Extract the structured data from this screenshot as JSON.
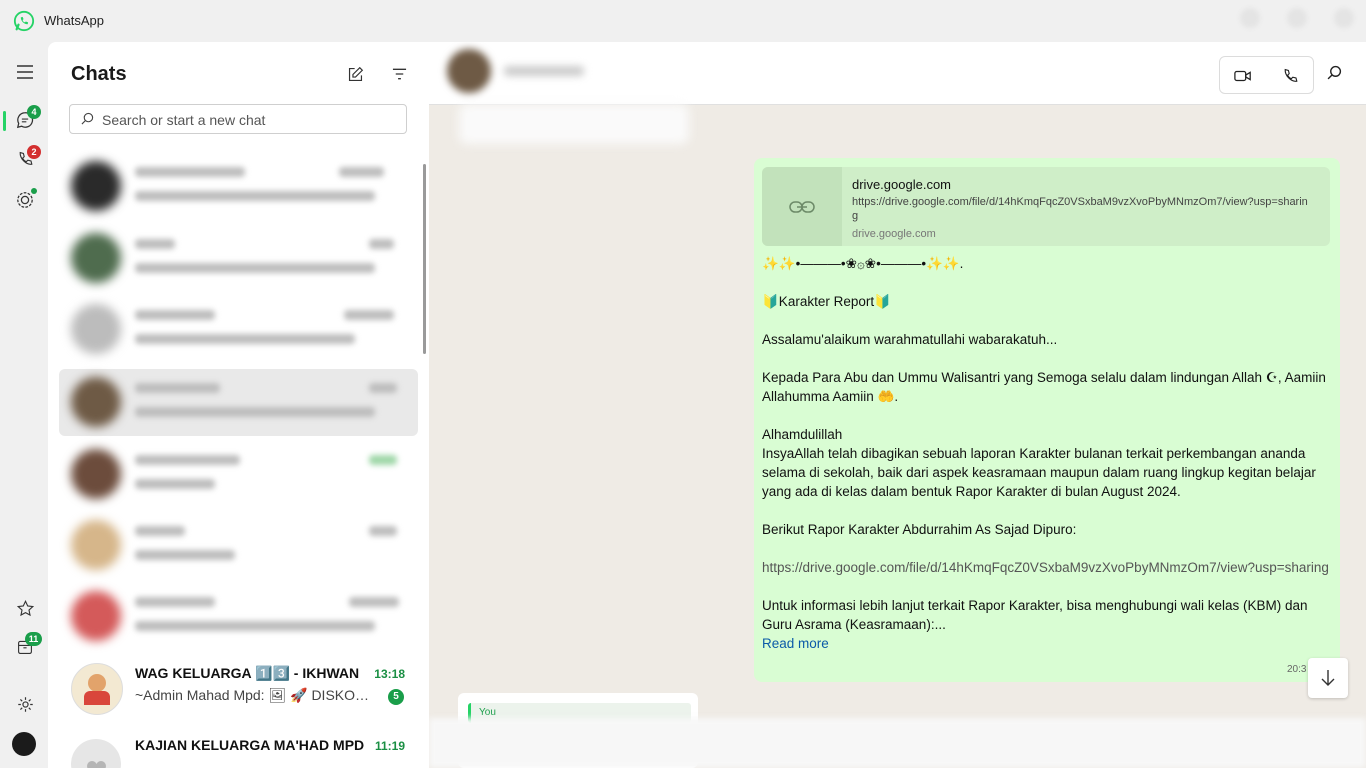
{
  "app": {
    "title": "WhatsApp",
    "accent": "#25d366",
    "logo_icon": "whatsapp-logo-icon"
  },
  "rail": {
    "chats_badge": "4",
    "calls_badge": "2",
    "archive_badge": "11",
    "icons": [
      "menu-icon",
      "chat-icon",
      "phone-icon",
      "status-icon",
      "star-icon",
      "archive-icon",
      "gear-icon",
      "avatar"
    ]
  },
  "chat_list": {
    "title": "Chats",
    "search_placeholder": "Search or start a new chat",
    "chats": [
      {
        "name": "WAG KELUARGA 1️⃣3️⃣ - IKHWAN",
        "time": "13:18",
        "preview": "~Admin Mahad Mpd: 🖼 🚀 DISKON...",
        "unread": "5"
      },
      {
        "name": "KAJIAN KELUARGA MA'HAD MPD",
        "time": "11:19",
        "preview": "",
        "unread": ""
      }
    ]
  },
  "conversation": {
    "link_preview": {
      "title": "drive.google.com",
      "url": "https://drive.google.com/file/d/14hKmqFqcZ0VSxbaM9vzXvoPbyMNmzOm7/view?usp=sharing",
      "domain": "drive.google.com"
    },
    "message": {
      "ornament": "✨✨•―――•❀۞❀•―――•✨✨.",
      "heading": "🔰Karakter Report🔰",
      "greeting": "Assalamu'alaikum warahmatullahi wabarakatuh...",
      "para1": "Kepada Para Abu dan Ummu Walisantri yang Semoga selalu dalam lindungan Allah ☪, Aamiin Allahumma Aamiin 🤲.",
      "alhamdulillah": "Alhamdulillah",
      "para2": "InsyaAllah telah dibagikan sebuah laporan Karakter bulanan terkait perkembangan ananda selama di sekolah, baik dari aspek keasramaan maupun dalam ruang lingkup kegitan belajar yang ada di kelas dalam bentuk Rapor Karakter di bulan August 2024.",
      "para3": "Berikut Rapor Karakter Abdurrahim As Sajad Dipuro:",
      "link": "https://drive.google.com/file/d/14hKmqFqcZ0VSxbaM9vzXvoPbyMNmzOm7/view?usp=sharing",
      "para4": "Untuk informasi lebih lanjut terkait Rapor Karakter, bisa  menghubungi wali kelas (KBM) dan Guru Asrama (Keasramaan):...",
      "read_more": "Read more",
      "time": "20:3"
    },
    "reply_sender": "You",
    "bubble_color": "#d9fdd3"
  }
}
